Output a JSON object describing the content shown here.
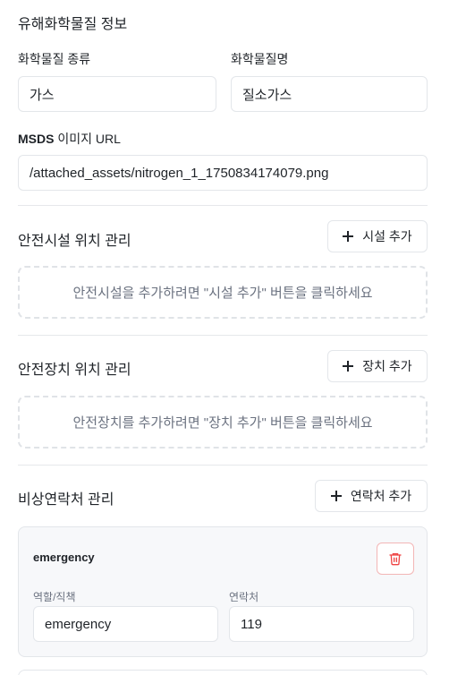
{
  "hazmat": {
    "title": "유해화학물질 정보",
    "type_label": "화학물질 종류",
    "type_value": "가스",
    "name_label": "화학물질명",
    "name_value": "질소가스",
    "msds_label_prefix": "MSDS",
    "msds_label_suffix": " 이미지 URL",
    "msds_value": "/attached_assets/nitrogen_1_1750834174079.png"
  },
  "facility": {
    "title": "안전시설 위치 관리",
    "add_label": "시설 추가",
    "empty_text": "안전시설을 추가하려면 \"시설 추가\" 버튼을 클릭하세요"
  },
  "device": {
    "title": "안전장치 위치 관리",
    "add_label": "장치 추가",
    "empty_text": "안전장치를 추가하려면 \"장치 추가\" 버튼을 클릭하세요"
  },
  "contacts": {
    "title": "비상연락처 관리",
    "add_label": "연락처 추가",
    "items": [
      {
        "name": "emergency",
        "role_label": "역할/직책",
        "role_value": "emergency",
        "phone_label": "연락처",
        "phone_value": "119"
      }
    ]
  },
  "icons": {
    "add": "plus-icon",
    "delete": "trash-icon"
  },
  "colors": {
    "danger": "#ef4444",
    "border": "#e3e6ea",
    "muted_text": "#6b7280",
    "card_bg": "#f7f8fa"
  }
}
